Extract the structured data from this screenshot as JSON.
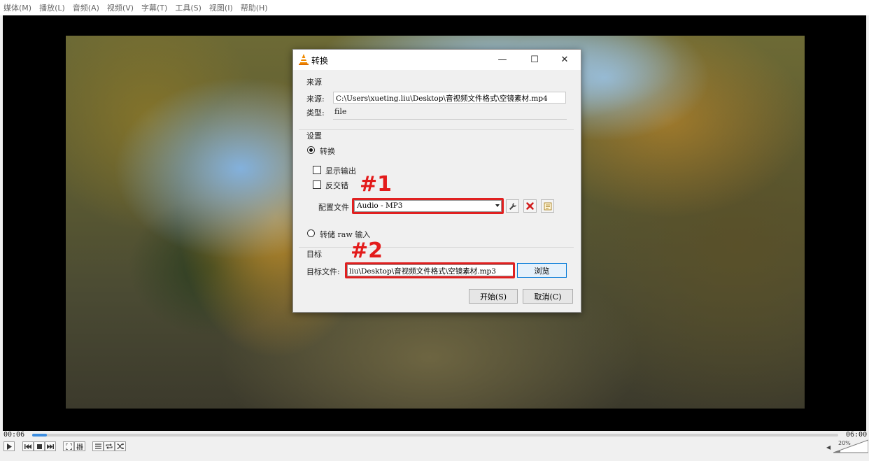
{
  "menu": {
    "items": [
      "媒体(M)",
      "播放(L)",
      "音频(A)",
      "视频(V)",
      "字幕(T)",
      "工具(S)",
      "视图(I)",
      "帮助(H)"
    ]
  },
  "dialog": {
    "title": "转换",
    "window_controls": {
      "minimize": "—",
      "maximize": "☐",
      "close": "✕"
    },
    "source": {
      "group_title": "来源",
      "source_label": "来源:",
      "source_value": "C:\\Users\\xueting.liu\\Desktop\\音视频文件格式\\空镜素材.mp4",
      "type_label": "类型:",
      "type_value": "file"
    },
    "settings": {
      "group_title": "设置",
      "convert_radio": "转换",
      "convert_selected": true,
      "show_output": "显示输出",
      "show_output_checked": false,
      "deinterlace": "反交错",
      "deinterlace_checked": false,
      "profile_label": "配置文件",
      "profile_value": "Audio - MP3",
      "profile_tools": [
        "wrench-icon",
        "delete-icon",
        "new-profile-icon"
      ],
      "raw_radio": "转储 raw 输入",
      "raw_selected": false
    },
    "target": {
      "group_title": "目标",
      "dest_label": "目标文件:",
      "dest_value": "liu\\Desktop\\音视频文件格式\\空镜素材.mp3",
      "browse": "浏览"
    },
    "buttons": {
      "start": "开始(S)",
      "cancel": "取消(C)"
    }
  },
  "annotations": {
    "first": "#1",
    "second": "#2",
    "highlight_color": "#e02020"
  },
  "controls": {
    "elapsed": "00:06",
    "total": "06:00",
    "progress": 0.017,
    "volume": "20%",
    "buttons": [
      "play-icon",
      "prev-icon",
      "stop-icon",
      "next-icon",
      "fullscreen-icon",
      "equalizer-icon",
      "playlist-icon",
      "loop-icon",
      "shuffle-icon"
    ]
  }
}
